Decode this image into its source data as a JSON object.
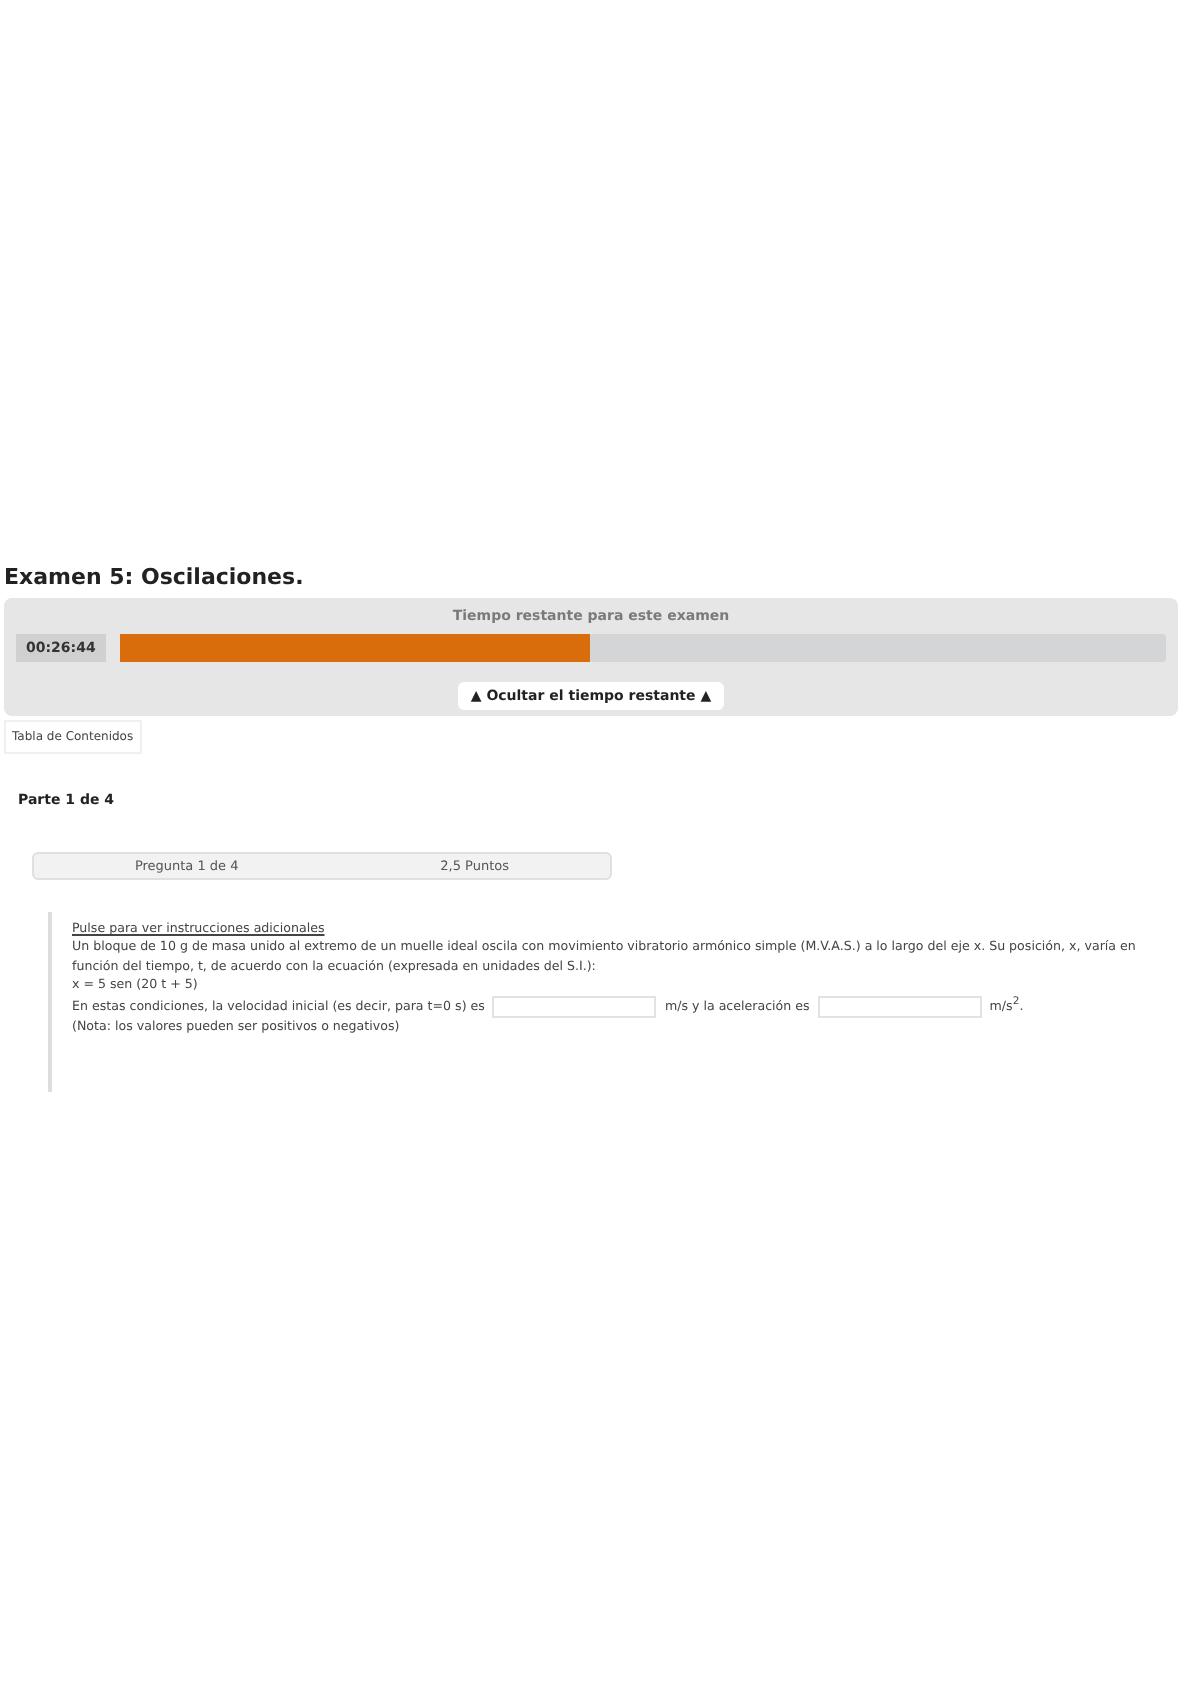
{
  "title": "Examen 5: Oscilaciones.",
  "timer": {
    "label": "Tiempo restante para este examen",
    "time": "00:26:44",
    "level": 0.45,
    "toggle": "▲ Ocultar el tiempo restante ▲"
  },
  "toc_button": "Tabla de Contenidos",
  "part": "Parte 1 de 4",
  "question_bar": {
    "question": "Pregunta 1 de 4",
    "points": "2,5 Puntos"
  },
  "question": {
    "instructions_link": "Pulse para ver instrucciones adicionales",
    "statement": "Un bloque de 10 g de masa unido al extremo de un muelle ideal oscila con movimiento vibratorio armónico simple (M.V.A.S.) a lo largo del eje x. Su posición, x, varía en función del tiempo, t, de acuerdo con la ecuación (expresada en unidades del S.I.):",
    "equation": "x = 5 sen (20 t + 5)",
    "answer_parts": [
      "En estas condiciones, la velocidad inicial (es decir, para t=0 s) es",
      "m/s y la aceleración es",
      "m/s$^{2}$."
    ],
    "note": "(Nota: los valores pueden ser positivos o negativos)"
  }
}
